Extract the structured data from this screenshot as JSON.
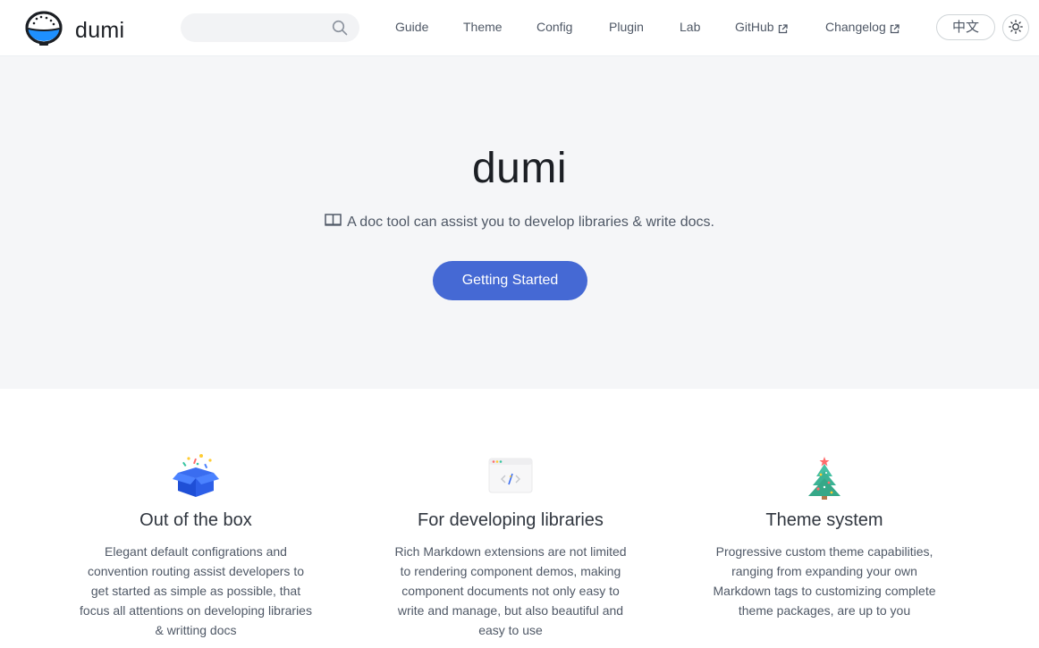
{
  "header": {
    "logo_text": "dumi",
    "search": {
      "placeholder": "",
      "value": ""
    },
    "nav": [
      {
        "label": "Guide"
      },
      {
        "label": "Theme"
      },
      {
        "label": "Config"
      },
      {
        "label": "Plugin"
      },
      {
        "label": "Lab"
      },
      {
        "label": "GitHub",
        "external": true
      },
      {
        "label": "Changelog",
        "external": true
      }
    ],
    "lang_label": "中文",
    "theme_icon": "sun-icon"
  },
  "hero": {
    "title": "dumi",
    "description": "A doc tool can assist you to develop libraries & write docs.",
    "description_icon": "book-icon",
    "button_label": "Getting Started",
    "button_color": "#4569d4"
  },
  "features": [
    {
      "icon": "gift-box-icon",
      "title": "Out of the box",
      "description": "Elegant default configrations and convention routing assist developers to get started as simple as possible, that focus all attentions on developing libraries & writting docs"
    },
    {
      "icon": "code-window-icon",
      "title": "For developing libraries",
      "description": "Rich Markdown extensions are not limited to rendering component demos, making component documents not only easy to write and manage, but also beautiful and easy to use"
    },
    {
      "icon": "christmas-tree-icon",
      "title": "Theme system",
      "description": "Progressive custom theme capabilities, ranging from expanding your own Markdown tags to customizing complete theme packages, are up to you"
    }
  ],
  "colors": {
    "accent": "#4569d4",
    "hero_bg": "#f5f6f8",
    "text_dark": "#1c1f24",
    "text": "#4f5866"
  }
}
